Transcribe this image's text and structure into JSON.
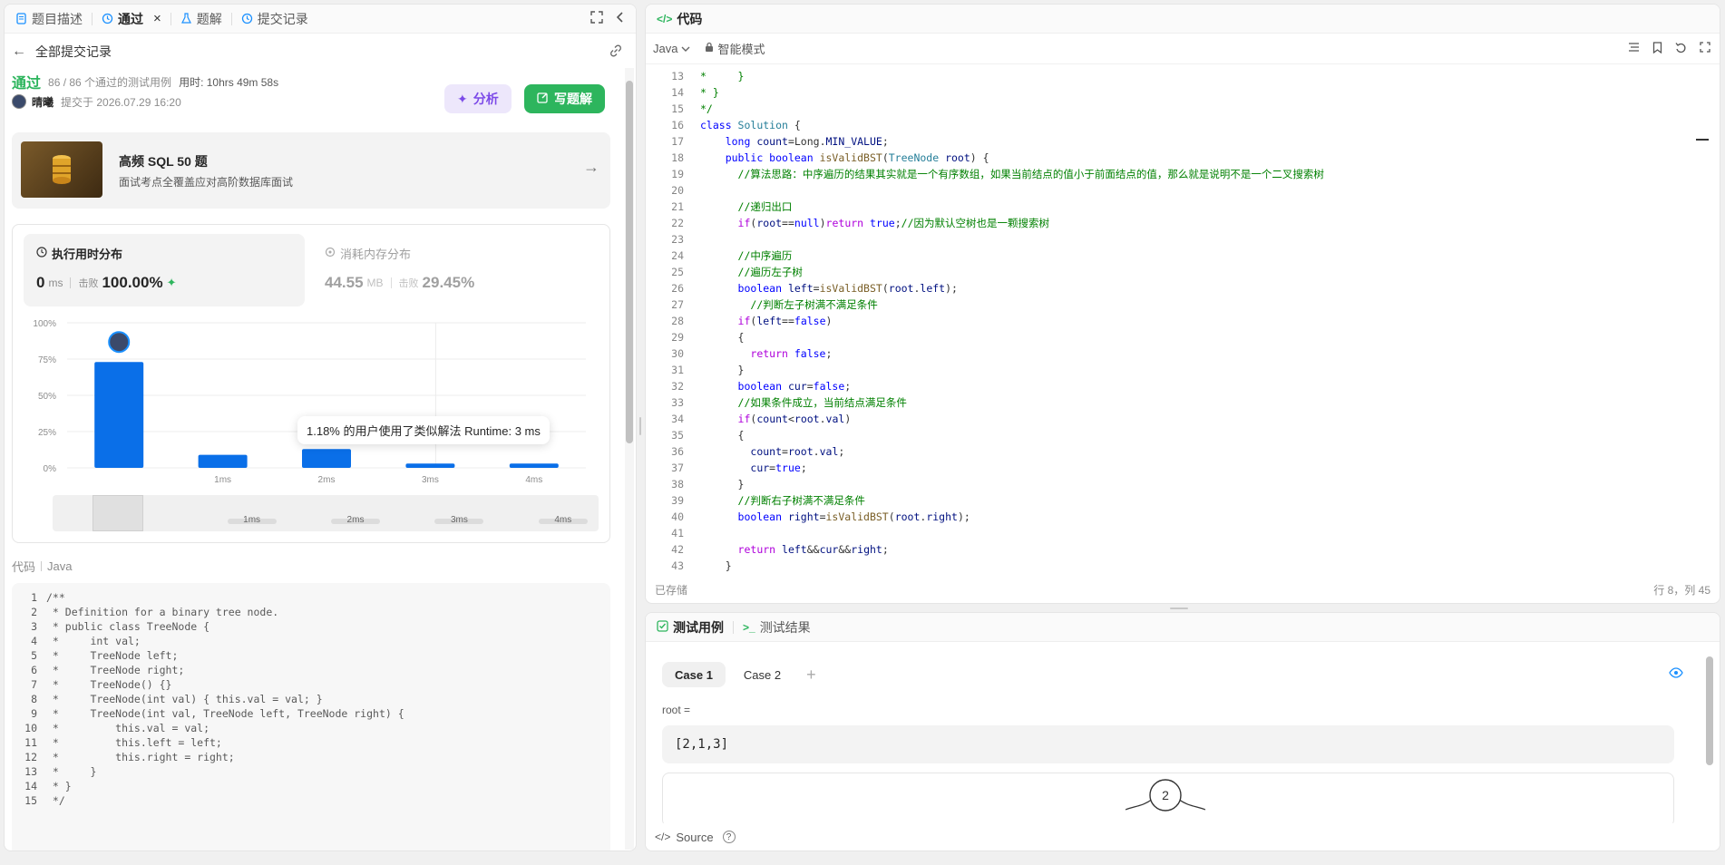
{
  "left_tabs": [
    {
      "label": "题目描述",
      "icon": "doc-icon"
    },
    {
      "label": "通过",
      "icon": "history-icon"
    },
    {
      "label": "题解",
      "icon": "flask-icon"
    },
    {
      "label": "提交记录",
      "icon": "history-icon"
    }
  ],
  "back_label": "全部提交记录",
  "submission": {
    "status": "通过",
    "cases": "86 / 86 个通过的测试用例",
    "time_used": "用时: 10hrs 49m 58s",
    "user": "晴曦",
    "submitted_at": "提交于 2026.07.29 16:20",
    "analyze_label": "分析",
    "write_solution_label": "写题解"
  },
  "promo": {
    "title": "高频 SQL 50 题",
    "subtitle": "面试考点全覆盖应对高阶数据库面试"
  },
  "runtime": {
    "label": "执行用时分布",
    "value": "0",
    "unit": "ms",
    "beats_label": "击败",
    "beats": "100.00%"
  },
  "memory": {
    "label": "消耗内存分布",
    "value": "44.55",
    "unit": "MB",
    "beats_label": "击败",
    "beats": "29.45%"
  },
  "chart_data": {
    "type": "bar",
    "categories": [
      "0ms",
      "1ms",
      "2ms",
      "3ms",
      "4ms"
    ],
    "x_tick_labels": [
      "",
      "1ms",
      "2ms",
      "3ms",
      "4ms"
    ],
    "values": [
      73,
      9,
      13,
      3,
      3
    ],
    "y_ticks": [
      "100%",
      "75%",
      "50%",
      "25%",
      "0%"
    ],
    "ylim": [
      0,
      100
    ],
    "grid": true,
    "tooltip": "1.18% 的用户使用了类似解法 Runtime: 3 ms",
    "bar_color": "#0a6fe8",
    "mini_labels": [
      "",
      "1ms",
      "2ms",
      "3ms",
      "4ms"
    ]
  },
  "code_label": "代码",
  "code_lang": "Java",
  "left_code": [
    "/**",
    " * Definition for a binary tree node.",
    " * public class TreeNode {",
    " *     int val;",
    " *     TreeNode left;",
    " *     TreeNode right;",
    " *     TreeNode() {}",
    " *     TreeNode(int val) { this.val = val; }",
    " *     TreeNode(int val, TreeNode left, TreeNode right) {",
    " *         this.val = val;",
    " *         this.left = left;",
    " *         this.right = right;",
    " *     }",
    " * }",
    " */"
  ],
  "editor": {
    "tab_label": "代码",
    "language": "Java",
    "mode": "智能模式",
    "saved": "已存储",
    "cursor": "行 8，列 45",
    "start_line": 13,
    "lines": [
      [
        [
          "cm",
          "*     }"
        ]
      ],
      [
        [
          "cm",
          "* }"
        ]
      ],
      [
        [
          "cm",
          "*/"
        ]
      ],
      [
        [
          "bl",
          "class "
        ],
        [
          "ty",
          "Solution"
        ],
        [
          "",
          " {"
        ]
      ],
      [
        [
          "",
          "    "
        ],
        [
          "bl",
          "long "
        ],
        [
          "nm",
          "count"
        ],
        [
          "",
          "=Long."
        ],
        [
          "nm",
          "MIN_VALUE"
        ],
        [
          "",
          ";"
        ]
      ],
      [
        [
          "",
          "    "
        ],
        [
          "bl",
          "public boolean "
        ],
        [
          "fn",
          "isValidBST"
        ],
        [
          "",
          "("
        ],
        [
          "ty",
          "TreeNode"
        ],
        [
          "nm",
          " root"
        ],
        [
          "",
          ") {"
        ]
      ],
      [
        [
          "",
          "      "
        ],
        [
          "cm",
          "//算法思路：中序遍历的结果其实就是一个有序数组，如果当前结点的值小于前面结点的值，那么就是说明不是一个二叉搜索树"
        ]
      ],
      [
        [
          "",
          ""
        ]
      ],
      [
        [
          "",
          "      "
        ],
        [
          "cm",
          "//递归出口"
        ]
      ],
      [
        [
          "",
          "      "
        ],
        [
          "kw",
          "if"
        ],
        [
          "",
          "("
        ],
        [
          "nm",
          "root"
        ],
        [
          "",
          "=="
        ],
        [
          "bl",
          "null"
        ],
        [
          "",
          ")"
        ],
        [
          "kw",
          "return "
        ],
        [
          "bl",
          "true"
        ],
        [
          "",
          ";"
        ],
        [
          "cm",
          "//因为默认空树也是一颗搜索树"
        ]
      ],
      [
        [
          "",
          ""
        ]
      ],
      [
        [
          "",
          "      "
        ],
        [
          "cm",
          "//中序遍历"
        ]
      ],
      [
        [
          "",
          "      "
        ],
        [
          "cm",
          "//遍历左子树"
        ]
      ],
      [
        [
          "",
          "      "
        ],
        [
          "bl",
          "boolean "
        ],
        [
          "nm",
          "left"
        ],
        [
          "",
          "="
        ],
        [
          "fn",
          "isValidBST"
        ],
        [
          "",
          "("
        ],
        [
          "nm",
          "root"
        ],
        [
          "",
          "."
        ],
        [
          "nm",
          "left"
        ],
        [
          "",
          ");"
        ]
      ],
      [
        [
          "",
          "        "
        ],
        [
          "cm",
          "//判断左子树满不满足条件"
        ]
      ],
      [
        [
          "",
          "      "
        ],
        [
          "kw",
          "if"
        ],
        [
          "",
          "("
        ],
        [
          "nm",
          "left"
        ],
        [
          "",
          "=="
        ],
        [
          "bl",
          "false"
        ],
        [
          "",
          ")"
        ]
      ],
      [
        [
          "",
          "      {"
        ]
      ],
      [
        [
          "",
          "        "
        ],
        [
          "kw",
          "return "
        ],
        [
          "bl",
          "false"
        ],
        [
          "",
          ";"
        ]
      ],
      [
        [
          "",
          "      }"
        ]
      ],
      [
        [
          "",
          "      "
        ],
        [
          "bl",
          "boolean "
        ],
        [
          "nm",
          "cur"
        ],
        [
          "",
          "="
        ],
        [
          "bl",
          "false"
        ],
        [
          "",
          ";"
        ]
      ],
      [
        [
          "",
          "      "
        ],
        [
          "cm",
          "//如果条件成立，当前结点满足条件"
        ]
      ],
      [
        [
          "",
          "      "
        ],
        [
          "kw",
          "if"
        ],
        [
          "",
          "("
        ],
        [
          "nm",
          "count"
        ],
        [
          "",
          "<"
        ],
        [
          "nm",
          "root"
        ],
        [
          "",
          "."
        ],
        [
          "nm",
          "val"
        ],
        [
          "",
          ")"
        ]
      ],
      [
        [
          "",
          "      {"
        ]
      ],
      [
        [
          "",
          "        "
        ],
        [
          "nm",
          "count"
        ],
        [
          "",
          "="
        ],
        [
          "nm",
          "root"
        ],
        [
          "",
          "."
        ],
        [
          "nm",
          "val"
        ],
        [
          "",
          ";"
        ]
      ],
      [
        [
          "",
          "        "
        ],
        [
          "nm",
          "cur"
        ],
        [
          "",
          "="
        ],
        [
          "bl",
          "true"
        ],
        [
          "",
          ";"
        ]
      ],
      [
        [
          "",
          "      }"
        ]
      ],
      [
        [
          "",
          "      "
        ],
        [
          "cm",
          "//判断右子树满不满足条件"
        ]
      ],
      [
        [
          "",
          "      "
        ],
        [
          "bl",
          "boolean "
        ],
        [
          "nm",
          "right"
        ],
        [
          "",
          "="
        ],
        [
          "fn",
          "isValidBST"
        ],
        [
          "",
          "("
        ],
        [
          "nm",
          "root"
        ],
        [
          "",
          "."
        ],
        [
          "nm",
          "right"
        ],
        [
          "",
          ");"
        ]
      ],
      [
        [
          "",
          ""
        ]
      ],
      [
        [
          "",
          "      "
        ],
        [
          "kw",
          "return "
        ],
        [
          "nm",
          "left"
        ],
        [
          "",
          "&&"
        ],
        [
          "nm",
          "cur"
        ],
        [
          "",
          "&&"
        ],
        [
          "nm",
          "right"
        ],
        [
          "",
          ";"
        ]
      ],
      [
        [
          "",
          "    }"
        ]
      ]
    ]
  },
  "test_tabs": [
    {
      "label": "测试用例",
      "icon": "checkbox-icon"
    },
    {
      "label": "测试结果",
      "icon": "terminal-icon"
    }
  ],
  "cases": [
    "Case 1",
    "Case 2"
  ],
  "add_case": "+",
  "input_label": "root =",
  "input_value": "[2,1,3]",
  "tree_root": "2",
  "source_label": "Source"
}
